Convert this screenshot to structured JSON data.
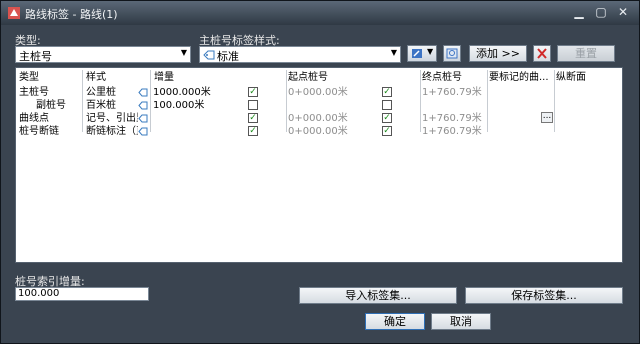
{
  "window": {
    "title": "路线标签 - 路线(1)"
  },
  "type_section": {
    "label": "类型:",
    "selected": "主桩号"
  },
  "style_section": {
    "label": "主桩号标签样式:",
    "selected": "标准"
  },
  "toolbar": {
    "add_label": "添加 >>",
    "reset_label": "重置"
  },
  "grid": {
    "headers": [
      "类型",
      "样式",
      "增量",
      "起点桩号",
      "终点桩号",
      "要标记的曲...",
      "纵断面"
    ],
    "rows": [
      {
        "type": "主桩号",
        "style": "公里桩",
        "increment": "1000.000米",
        "start_checked": true,
        "start": "0+000.00米",
        "end_checked": true,
        "end": "1+760.79米",
        "curve": "",
        "profile": ""
      },
      {
        "type": "副桩号",
        "style": "百米桩",
        "increment": "100.000米",
        "start_checked": false,
        "start": "",
        "end_checked": false,
        "end": "",
        "curve": "",
        "profile": ""
      },
      {
        "type": "曲线点",
        "style": "记号、引出里",
        "increment": "",
        "start_checked": true,
        "start": "0+000.00米",
        "end_checked": true,
        "end": "1+760.79米",
        "curve": "...",
        "profile": ""
      },
      {
        "type": "桩号断链",
        "style": "断链标注（直",
        "increment": "",
        "start_checked": true,
        "start": "0+000.00米",
        "end_checked": true,
        "end": "1+760.79米",
        "curve": "",
        "profile": ""
      }
    ]
  },
  "increment_section": {
    "label": "桩号索引增量:",
    "value": "100.000"
  },
  "buttons": {
    "import_label": "导入标签集...",
    "save_label": "保存标签集...",
    "ok_label": "确定",
    "cancel_label": "取消"
  }
}
